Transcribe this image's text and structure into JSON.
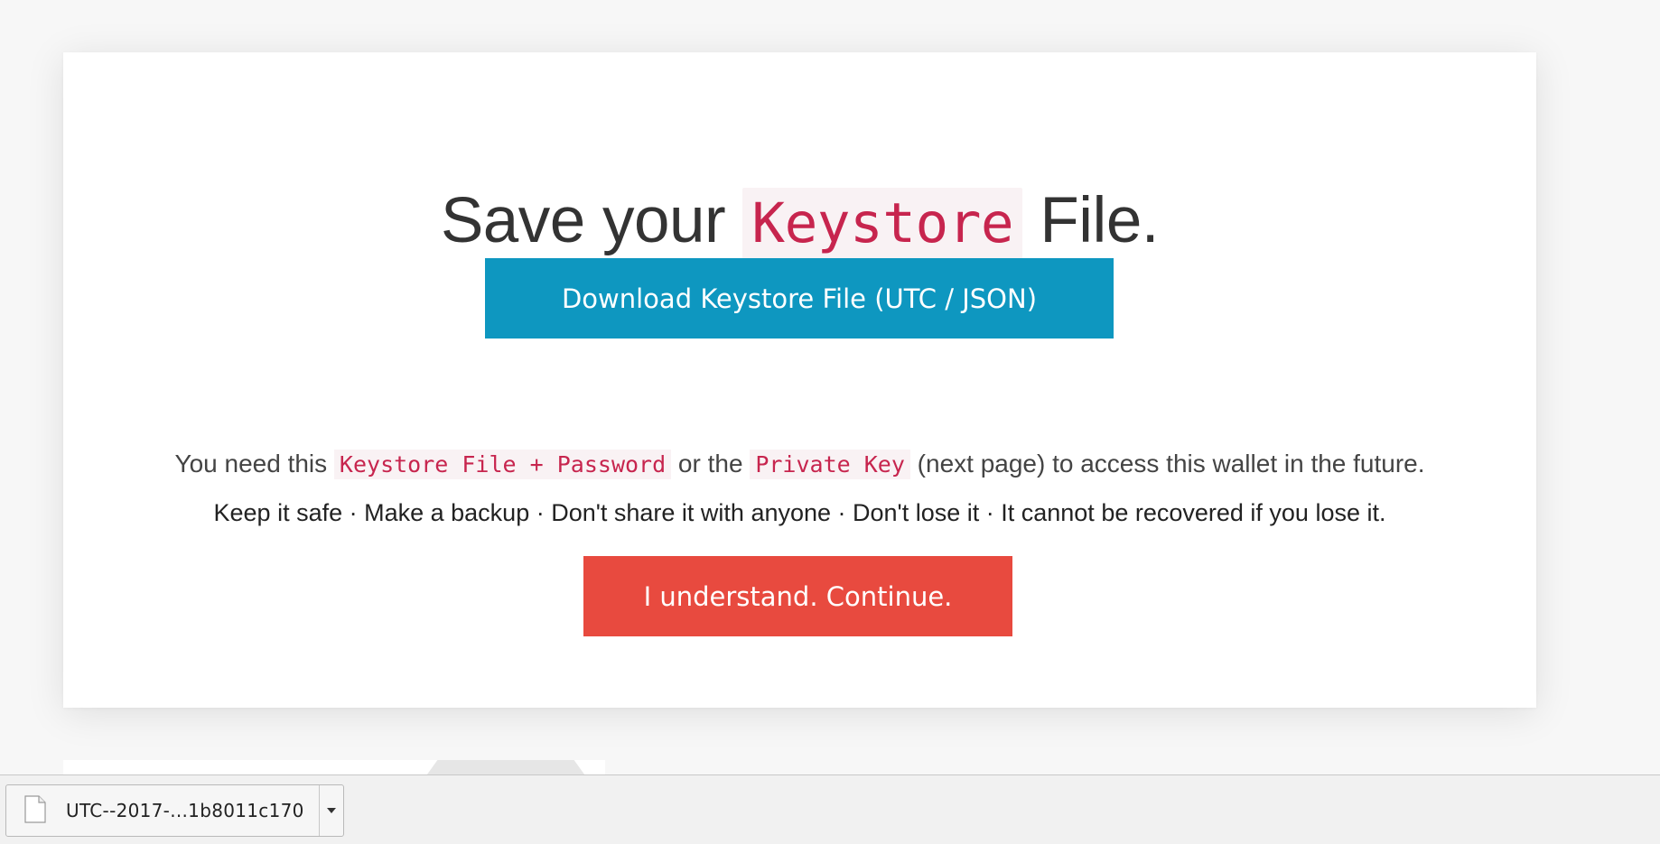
{
  "card": {
    "title_before": "Save your ",
    "title_code": "Keystore",
    "title_after": " File.",
    "download_button_label": "Download Keystore File (UTC / JSON)",
    "info": {
      "part1": "You need this ",
      "code1": "Keystore File + Password",
      "part2": " or the ",
      "code2": "Private Key",
      "part3": " (next page) to access this wallet in the future."
    },
    "warning": "Keep it safe · Make a backup · Don't share it with anyone · Don't lose it · It cannot be recovered if you lose it.",
    "continue_button_label": "I understand. Continue."
  },
  "download_bar": {
    "file_name": "UTC--2017-...1b8011c170",
    "file_icon": "document-icon",
    "menu_icon": "caret-down-icon"
  },
  "colors": {
    "download_button": "#0e97c0",
    "continue_button": "#e84a3f",
    "code_text": "#c7254e",
    "code_background": "#f9f2f4"
  }
}
